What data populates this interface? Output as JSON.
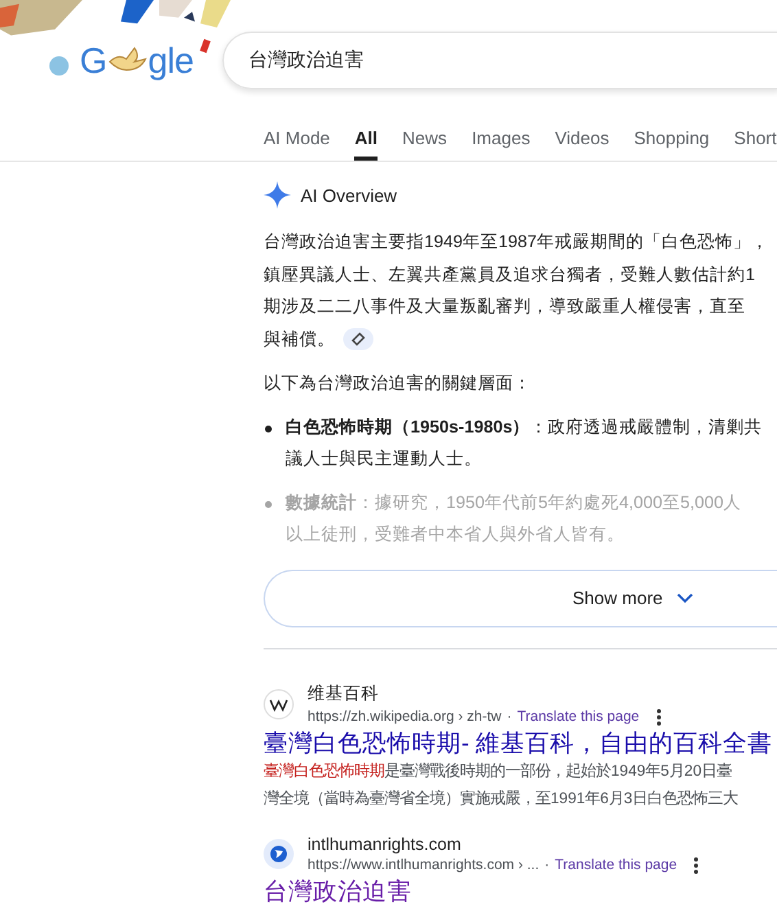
{
  "logo": {
    "before": "G",
    "after": "gle"
  },
  "search": {
    "value": "台灣政治迫害"
  },
  "tabs": [
    {
      "label": "AI Mode",
      "selected": false
    },
    {
      "label": "All",
      "selected": true
    },
    {
      "label": "News",
      "selected": false
    },
    {
      "label": "Images",
      "selected": false
    },
    {
      "label": "Videos",
      "selected": false
    },
    {
      "label": "Shopping",
      "selected": false
    },
    {
      "label": "Short",
      "selected": false
    }
  ],
  "ai_overview": {
    "title": "AI Overview",
    "paragraph_lines": [
      "台灣政治迫害主要指1949年至1987年戒嚴期間的「白色恐怖」，",
      "鎮壓異議人士、左翼共產黨員及追求台獨者，受難人數估計約1",
      "期涉及二二八事件及大量叛亂審判，導致嚴重人權侵害，直至",
      "與補償。"
    ],
    "intro": "以下為台灣政治迫害的關鍵層面：",
    "bullets": [
      {
        "lines": [
          "**白色恐怖時期（1950s-1980s）**：政府透過戒嚴體制，清剿共",
          "議人士與民主運動人士。"
        ],
        "faded": false
      },
      {
        "lines": [
          "**數據統計**：據研究，1950年代前5年約處死4,000至5,000人",
          "以上徒刑，受難者中本省人與外省人皆有。"
        ],
        "faded": true
      }
    ],
    "show_more": "Show more"
  },
  "results": [
    {
      "kind": "wiki",
      "site": "维基百科",
      "url": "https://zh.wikipedia.org › zh-tw",
      "separator": "·",
      "translate": "Translate this page",
      "title": "臺灣白色恐怖時期- 維基百科，自由的百科全書",
      "visited": false,
      "snippet_lines": [
        {
          "highlight": "臺灣白色恐怖時期",
          "text": "是臺灣戰後時期的一部份，起始於1949年5月20日臺"
        },
        {
          "text": "灣全境（當時為臺灣省全境）實施戒嚴，至1991年6月3日白色恐怖三大"
        }
      ]
    },
    {
      "kind": "globe",
      "site": "intlhumanrights.com",
      "url": "https://www.intlhumanrights.com › ...",
      "separator": "·",
      "translate": "Translate this page",
      "title": "台灣政治迫害",
      "visited": true
    }
  ]
}
